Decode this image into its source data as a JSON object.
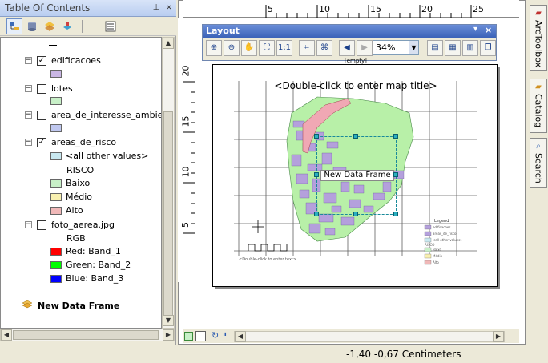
{
  "toc": {
    "title": "Table Of Contents",
    "pin_icon": "pin-icon",
    "close_icon": "close-icon",
    "layers": [
      {
        "name": "edificacoes",
        "checked": true,
        "swatch": "#c9b6e4"
      },
      {
        "name": "lotes",
        "checked": false,
        "swatch": "#c8f0c8"
      },
      {
        "name": "area_de_interesse_ambient",
        "checked": false,
        "swatch": "#c0c8f0"
      },
      {
        "name": "areas_de_risco",
        "checked": true
      }
    ],
    "risk_other": "<all other values>",
    "risk_field": "RISCO",
    "risk_classes": [
      {
        "label": "Baixo",
        "color": "#c8f0c8"
      },
      {
        "label": "Médio",
        "color": "#f8f0b0"
      },
      {
        "label": "Alto",
        "color": "#f0b8b8"
      }
    ],
    "other_swatch": "#c8e8f0",
    "photo": {
      "name": "foto_aerea.jpg",
      "checked": false,
      "mode": "RGB"
    },
    "bands": [
      {
        "label": "Red:  Band_1",
        "color": "#ff0000"
      },
      {
        "label": "Green:  Band_2",
        "color": "#00ff00"
      },
      {
        "label": "Blue:  Band_3",
        "color": "#0000ff"
      }
    ],
    "data_frame": "New Data Frame"
  },
  "rulers": {
    "top": [
      "5",
      "10",
      "15",
      "20",
      "25"
    ],
    "left": [
      "20",
      "15",
      "10",
      "5"
    ]
  },
  "layout_toolbar": {
    "title": "Layout",
    "zoom_value": "34%",
    "empty_label": "[empty]"
  },
  "map": {
    "title": "<Double-click to enter map title>",
    "data_frame_label": "New Data Frame",
    "legend_title": "Legend",
    "legend_items": [
      "edificacoes",
      "areas_de_risco",
      "<all other values>",
      "RISCO",
      "Baixo",
      "Médio",
      "Alto"
    ],
    "footer_text": "<Double-click to enter text>"
  },
  "status": {
    "coordinates": "-1,40  -0,67 Centimeters"
  },
  "dock_tabs": [
    "ArcToolbox",
    "Catalog",
    "Search"
  ],
  "colors": {
    "toc_header": "#c8d8f4",
    "layout_title": "#4a72c4",
    "map_base": "#b8f0a8",
    "buildings": "#b4a0dc",
    "high_risk": "#f0a8b4"
  }
}
